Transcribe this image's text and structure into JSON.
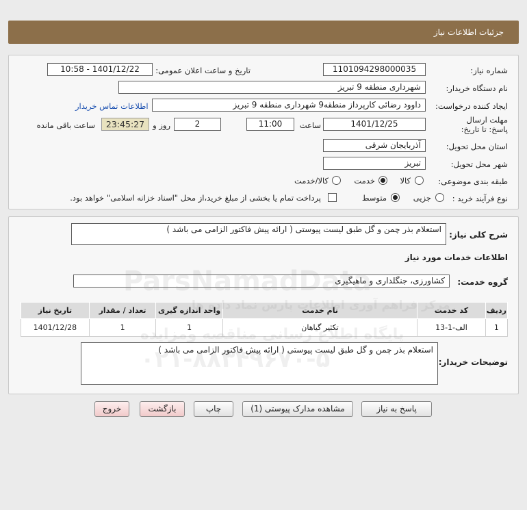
{
  "header": {
    "title": "جزئیات اطلاعات نیاز"
  },
  "form": {
    "need_number_label": "شماره نیاز:",
    "need_number": "1101094298000035",
    "announce_label": "تاریخ و ساعت اعلان عمومی:",
    "announce_value": "1401/12/22 - 10:58",
    "buyer_label": "نام دستگاه خریدار:",
    "buyer_value": "شهرداری منطقه 9 تبریز",
    "creator_label": "ایجاد کننده درخواست:",
    "creator_value": "داوود رضائی کارپرداز منطقه9 شهرداری منطقه 9 تبریز",
    "contact_link": "اطلاعات تماس خریدار",
    "deadline_label": "مهلت ارسال پاسخ: تا تاریخ:",
    "deadline_date": "1401/12/25",
    "time_label": "ساعت",
    "deadline_time": "11:00",
    "days_value": "2",
    "days_label": "روز و",
    "remaining_time": "23:45:27",
    "remaining_label": "ساعت باقی مانده",
    "province_label": "استان محل تحویل:",
    "province_value": "آذربایجان شرقی",
    "city_label": "شهر محل تحویل:",
    "city_value": "تبریز",
    "category_label": "طبقه بندی موضوعی:",
    "category_options": [
      "کالا",
      "خدمت",
      "کالا/خدمت"
    ],
    "category_selected": "خدمت",
    "process_label": "نوع فرآیند خرید :",
    "process_options": [
      "جزیی",
      "متوسط"
    ],
    "process_selected": "متوسط",
    "payment_note": "پرداخت تمام یا بخشی از مبلغ خرید،از محل \"اسناد خزانه اسلامی\" خواهد بود."
  },
  "details": {
    "general_label": "شرح کلی نیاز:",
    "general_value": "استعلام بذر چمن و گل طبق لیست پیوستی ( ارائه پیش فاکتور الزامی می باشد )",
    "services_title": "اطلاعات خدمات مورد نیاز",
    "group_label": "گروه خدمت:",
    "group_value": "کشاورزی، جنگلداری و ماهیگیری",
    "table": {
      "headers": [
        "ردیف",
        "کد خدمت",
        "نام خدمت",
        "واحد اندازه گیری",
        "تعداد / مقدار",
        "تاریخ نیاز"
      ],
      "rows": [
        [
          "1",
          "الف-1-13",
          "تکثیر گیاهان",
          "1",
          "1",
          "1401/12/28"
        ]
      ]
    },
    "buyer_desc_label": "توضیحات خریدار:",
    "buyer_desc_value": "استعلام بذر چمن و گل طبق لیست پیوستی ( ارائه پیش فاکتور الزامی می باشد )"
  },
  "buttons": {
    "reply": "پاسخ به نیاز",
    "docs": "مشاهده مدارک پیوستی (1)",
    "print": "چاپ",
    "back": "بازگشت",
    "exit": "خروج"
  },
  "watermark": {
    "brand": "ParsNamadData",
    "line1": "مرکز فراهم آوری اطلاعات پارس نماد داده ها",
    "line2": "پایگاه اطلاع رسانی مناقصه ومزایده",
    "phone": "۰۲۱-۸۸۳۴۹۶۷۰-۵"
  }
}
